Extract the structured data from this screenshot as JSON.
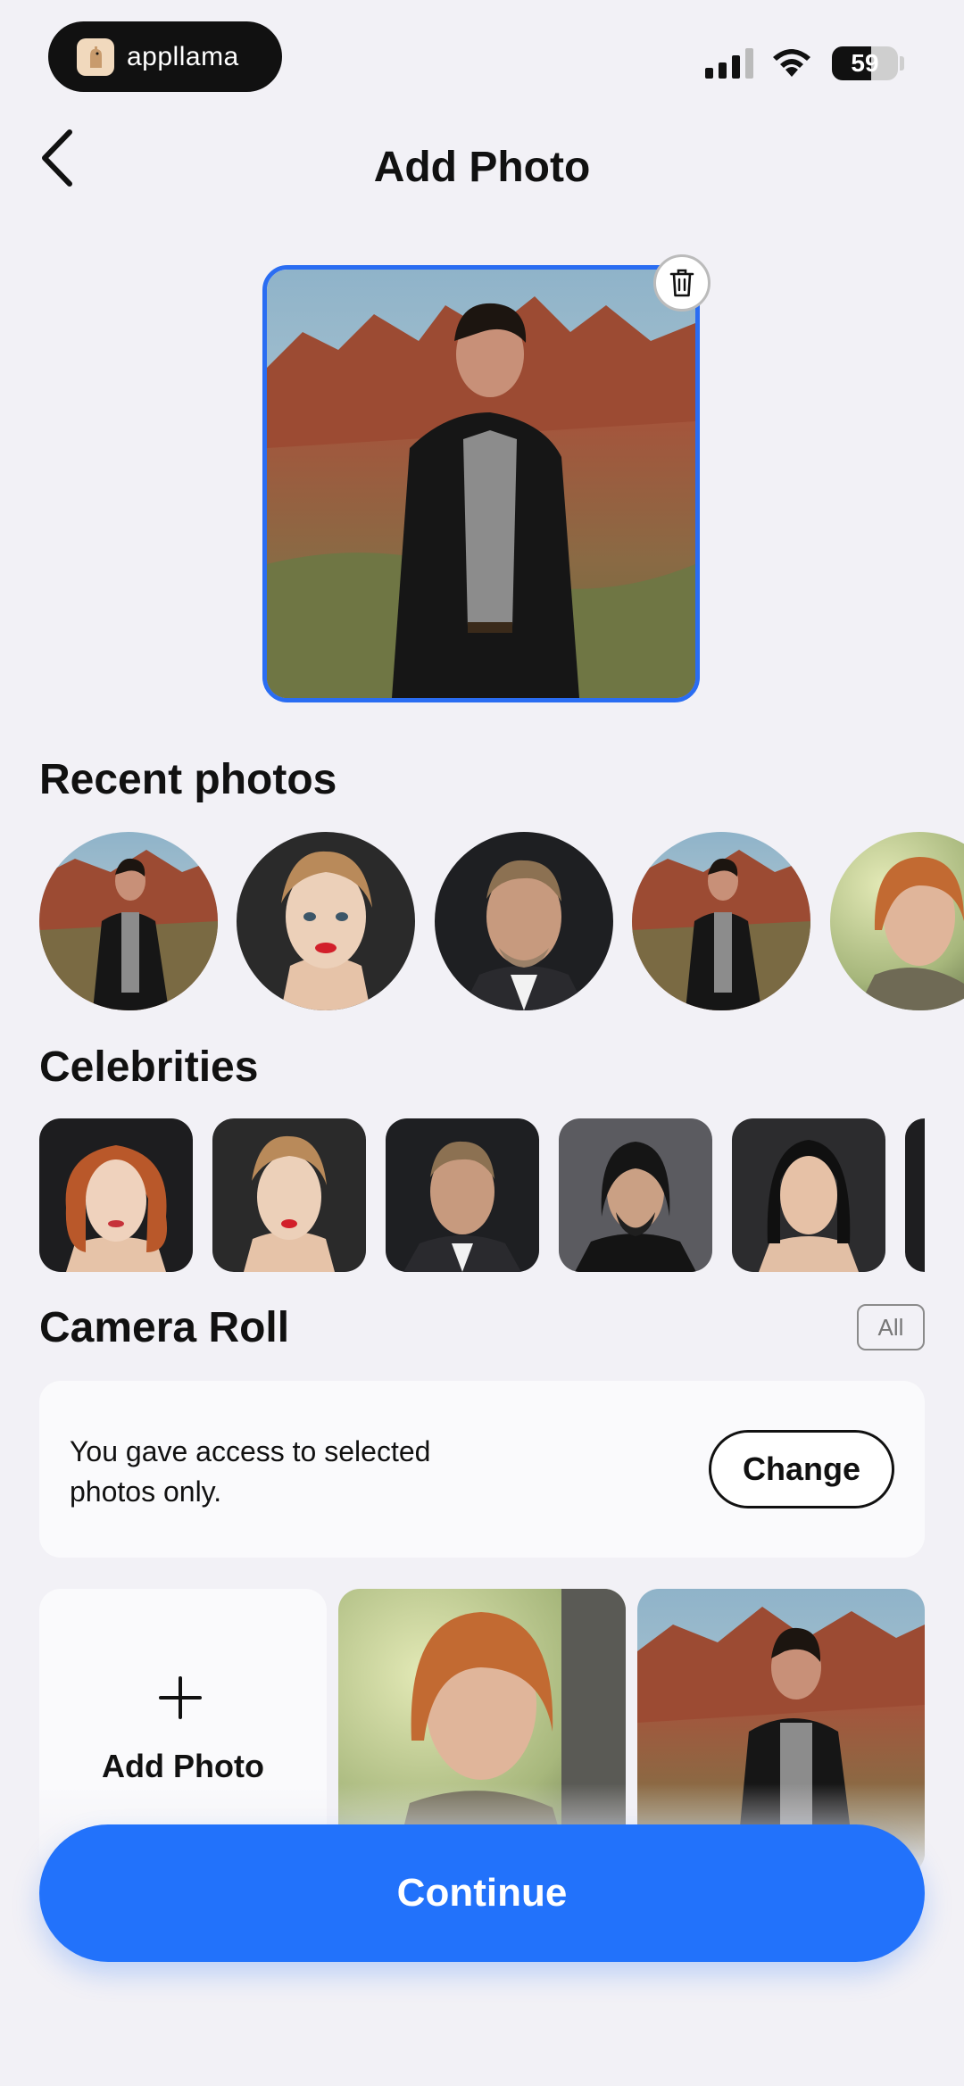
{
  "status_bar": {
    "brand": "appllama",
    "battery": "59",
    "battery_level": 0.59,
    "signal_bars": 3
  },
  "header": {
    "title": "Add Photo",
    "back_icon": "chevron-left-icon"
  },
  "selected_photo": {
    "delete_icon": "trash-icon",
    "accent": "#2a6df2"
  },
  "recent": {
    "title": "Recent photos"
  },
  "celebrities": {
    "title": "Celebrities"
  },
  "camera_roll": {
    "title": "Camera Roll",
    "all_label": "All",
    "access_text": "You gave access to selected photos only.",
    "change_label": "Change",
    "add_photo_label": "Add Photo",
    "add_icon": "plus-icon"
  },
  "footer": {
    "continue_label": "Continue",
    "accent": "#2272fb"
  }
}
